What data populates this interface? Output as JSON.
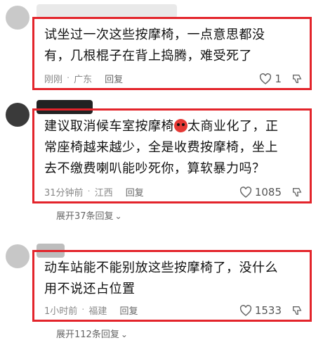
{
  "comments": [
    {
      "text_lines": [
        "试坐过一次这些按摩椅，一点意思都没",
        "有，几根棍子在背上捣腾，难受死了"
      ],
      "time": "刚刚",
      "location": "广东",
      "reply_label": "回复",
      "likes": "1"
    },
    {
      "text_lines": [
        "建议取消候车室按摩椅",
        "太商业化了，正",
        "常座椅越来越少，全是收费按摩椅，坐上",
        "去不缴费喇叭能吵死你，算软暴力吗？"
      ],
      "time": "31分钟前",
      "location": "江西",
      "reply_label": "回复",
      "likes": "1085",
      "expand_label": "展开37条回复"
    },
    {
      "text_lines": [
        "动车站能不能别放这些按摩椅了，没什么",
        "用不说还占位置"
      ],
      "time": "1小时前",
      "location": "福建",
      "reply_label": "回复",
      "likes": "1533",
      "expand_label": "展开112条回复"
    }
  ],
  "colors": {
    "highlight_border": "#e3242b"
  },
  "icons": {
    "like": "heart-outline-icon",
    "dislike": "thumbs-down-icon",
    "emoji": "angry-face-emoji-icon",
    "expand": "chevron-down-icon"
  }
}
